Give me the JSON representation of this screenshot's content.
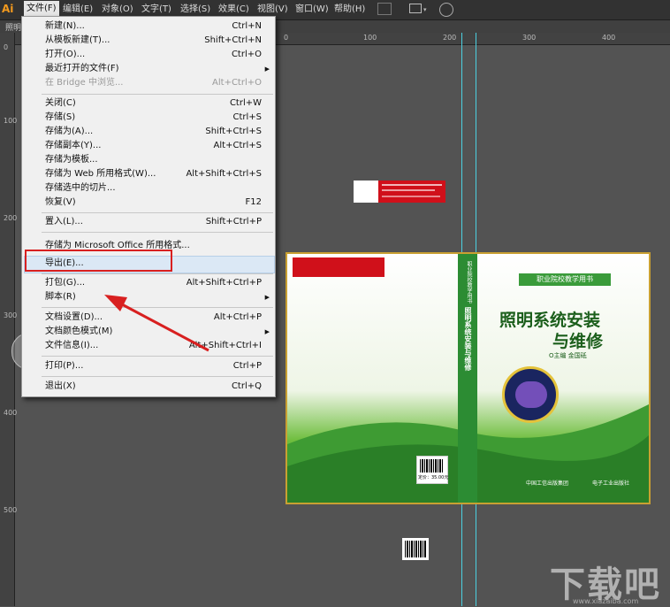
{
  "app": {
    "logo": "Ai"
  },
  "menubar": {
    "items": [
      "文件(F)",
      "编辑(E)",
      "对象(O)",
      "文字(T)",
      "选择(S)",
      "效果(C)",
      "视图(V)",
      "窗口(W)",
      "帮助(H)"
    ]
  },
  "tab": {
    "label": "照明"
  },
  "ruler": {
    "h": [
      "0",
      "100",
      "200",
      "300",
      "400"
    ],
    "v": [
      "0",
      "100",
      "200",
      "300",
      "400",
      "500"
    ]
  },
  "file_menu": {
    "items": [
      {
        "label": "新建(N)...",
        "shortcut": "Ctrl+N"
      },
      {
        "label": "从模板新建(T)...",
        "shortcut": "Shift+Ctrl+N"
      },
      {
        "label": "打开(O)...",
        "shortcut": "Ctrl+O"
      },
      {
        "label": "最近打开的文件(F)",
        "shortcut": ""
      },
      {
        "label": "在 Bridge 中浏览...",
        "shortcut": "Alt+Ctrl+O"
      },
      {
        "label": "关闭(C)",
        "shortcut": "Ctrl+W"
      },
      {
        "label": "存储(S)",
        "shortcut": "Ctrl+S"
      },
      {
        "label": "存储为(A)...",
        "shortcut": "Shift+Ctrl+S"
      },
      {
        "label": "存储副本(Y)...",
        "shortcut": "Alt+Ctrl+S"
      },
      {
        "label": "存储为模板...",
        "shortcut": ""
      },
      {
        "label": "存储为 Web 所用格式(W)...",
        "shortcut": "Alt+Shift+Ctrl+S"
      },
      {
        "label": "存储选中的切片...",
        "shortcut": ""
      },
      {
        "label": "恢复(V)",
        "shortcut": "F12"
      },
      {
        "label": "置入(L)...",
        "shortcut": "Shift+Ctrl+P"
      },
      {
        "label": "存储为 Microsoft Office 所用格式...",
        "shortcut": ""
      },
      {
        "label": "导出(E)...",
        "shortcut": ""
      },
      {
        "label": "打包(G)...",
        "shortcut": "Alt+Shift+Ctrl+P"
      },
      {
        "label": "脚本(R)",
        "shortcut": ""
      },
      {
        "label": "文档设置(D)...",
        "shortcut": "Alt+Ctrl+P"
      },
      {
        "label": "文档颜色模式(M)",
        "shortcut": ""
      },
      {
        "label": "文件信息(I)...",
        "shortcut": "Alt+Shift+Ctrl+I"
      },
      {
        "label": "打印(P)...",
        "shortcut": "Ctrl+P"
      },
      {
        "label": "退出(X)",
        "shortcut": "Ctrl+Q"
      }
    ]
  },
  "book_cover": {
    "series": "职业院校教学用书",
    "title_line1": "照明系统安装",
    "title_line2": "与维修",
    "author": "O主编 金国砥",
    "spine_title": "照明系统安装与维修",
    "spine_label": "职业院校教学用书",
    "publisher": "中国工信出版集团",
    "press": "电子工业出版社",
    "price": "定价：35.00元",
    "colors": {
      "green_dark": "#2e8b2e",
      "green_light": "#8fcf5a",
      "red": "#d0101a",
      "gold": "#c9a032"
    }
  },
  "watermark": {
    "text": "下载吧",
    "url": "www.xiazaiba.com"
  }
}
